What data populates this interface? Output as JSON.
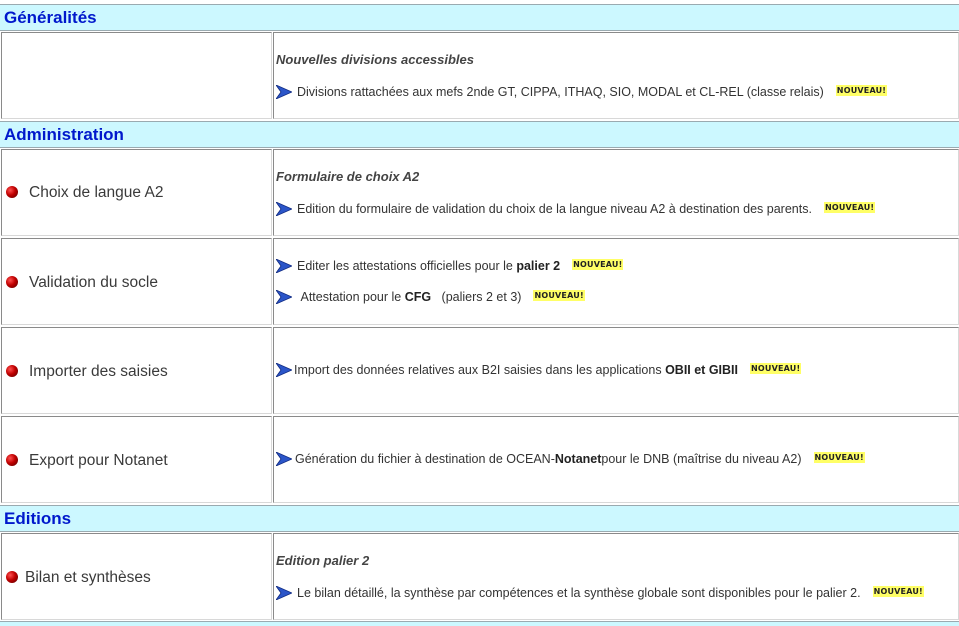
{
  "sections": {
    "generalites": "Généralités",
    "administration": "Administration",
    "editions": "Editions"
  },
  "badge": "NOUVEAU!",
  "rows": {
    "r1": {
      "label": "",
      "heading": "Nouvelles divisions accessibles",
      "lines": [
        "Divisions rattachées aux mefs 2nde GT, CIPPA, ITHAQ, SIO, MODAL et CL-REL (classe relais)"
      ]
    },
    "r2": {
      "label": "Choix de langue A2",
      "heading": "Formulaire de choix A2",
      "lines": [
        "Edition du formulaire de validation du choix de la langue niveau A2 à destination des parents."
      ]
    },
    "r3": {
      "label": "Validation du socle",
      "l1_pre": "Editer les attestations officielles pour le ",
      "l1_bold": "palier 2",
      "l2_pre": "Attestation pour le ",
      "l2_bold": "CFG",
      "l2_post": "(paliers 2 et 3)"
    },
    "r4": {
      "label": "Importer des saisies",
      "l1_pre": "Import des données relatives aux B2I saisies dans les applications ",
      "l1_bold": "OBII et GIBII"
    },
    "r5": {
      "label": "Export pour Notanet",
      "l1_pre": "Génération du fichier à destination de OCEAN-",
      "l1_bold": "Notanet",
      "l1_post": " pour le DNB (maîtrise du niveau A2)"
    },
    "r6": {
      "label": "Bilan et synthèses",
      "heading": "Edition palier 2",
      "lines": [
        "Le bilan détaillé, la synthèse par compétences et la synthèse globale sont disponibles pour le palier 2."
      ]
    }
  },
  "colors": {
    "section_bg": "#ccf8ff",
    "section_text": "#0018cc",
    "badge_bg": "#ffff66",
    "arrow": "#1a3fb0"
  }
}
